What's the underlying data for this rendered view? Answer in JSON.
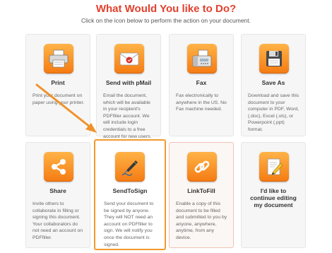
{
  "header": {
    "title": "What Would You like to Do?",
    "subtitle": "Click on the icon below to perform the action on your document."
  },
  "cards": [
    {
      "label": "Print",
      "description": "Print your document on paper using your printer.",
      "icon": "printer-icon"
    },
    {
      "label": "Send with pMail",
      "description": "Email the document, which will be available in your recipient's PDFfiller account. We will include login credentials to a free account for new users.",
      "icon": "envelope-icon"
    },
    {
      "label": "Fax",
      "description": "Fax electronically to anywhere in the US. No Fax machine needed.",
      "icon": "fax-icon"
    },
    {
      "label": "Save As",
      "description": "Download and save this document to your computer in PDF, Word, (.doc), Excel (.xls), or Powerpoint (.ppt) format.",
      "icon": "floppy-disk-icon"
    },
    {
      "label": "Share",
      "description": "Invite others to collaborate in filling or signing this document. Your collaborators do not need an account on PDFfiller.",
      "icon": "share-icon"
    },
    {
      "label": "SendToSign",
      "description": "Send your document to be signed by anyone. They will NOT need an account on PDFfiller to sign. We will notify you once the document is signed.",
      "icon": "pen-signature-icon"
    },
    {
      "label": "LinkToFill",
      "description": "Enable a copy of this document to be filled and submitted to you by anyone, anywhere, anytime, from any device.",
      "icon": "link-chain-icon"
    },
    {
      "label": "I'd like to continue editing my document",
      "description": "",
      "icon": "edit-document-icon"
    }
  ],
  "colors": {
    "title": "#e2402d",
    "accent_orange": "#f47b12",
    "highlight_border": "#f29a2a"
  }
}
